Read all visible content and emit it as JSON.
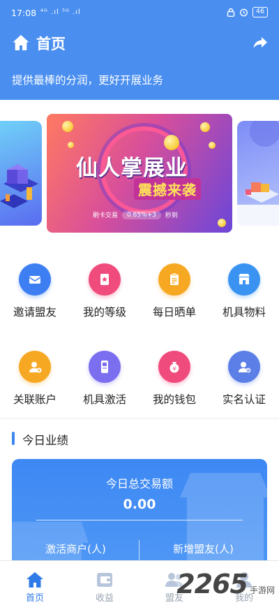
{
  "status": {
    "time": "17:08",
    "signal": "⁴ᴳ .ıl ⁵ᴳ .ıl",
    "battery": "46"
  },
  "header": {
    "title": "首页",
    "tagline": "提供最棒的分润，更好开展业务"
  },
  "banner": {
    "title": "仙人掌展业",
    "subtitle": "震撼来袭",
    "chip_left": "刷卡交易",
    "chip_mid": "0.65%+3",
    "chip_right": "秒到"
  },
  "grid": {
    "items": [
      {
        "label": "邀请盟友",
        "icon": "envelope-icon",
        "color": "#3d7ff2"
      },
      {
        "label": "我的等级",
        "icon": "bookmark-star-icon",
        "color": "#f04b7d"
      },
      {
        "label": "每日晒单",
        "icon": "clipboard-icon",
        "color": "#f7a823"
      },
      {
        "label": "机具物料",
        "icon": "store-icon",
        "color": "#3a93f0"
      },
      {
        "label": "关联账户",
        "icon": "user-add-icon",
        "color": "#f7a823"
      },
      {
        "label": "机具激活",
        "icon": "pos-device-icon",
        "color": "#7b6ff0"
      },
      {
        "label": "我的钱包",
        "icon": "money-bag-icon",
        "color": "#f04b7d"
      },
      {
        "label": "实名认证",
        "icon": "user-verified-icon",
        "color": "#5b7fe6"
      }
    ]
  },
  "performance": {
    "section_title": "今日业绩",
    "total_label": "今日总交易额",
    "total_value": "0.00",
    "col1_label": "激活商户(人)",
    "col2_label": "新增盟友(人)"
  },
  "tabs": [
    {
      "label": "首页",
      "icon": "home-icon"
    },
    {
      "label": "收益",
      "icon": "wallet-icon"
    },
    {
      "label": "盟友",
      "icon": "friends-icon"
    },
    {
      "label": "我的",
      "icon": "profile-icon"
    }
  ],
  "watermark": {
    "big": "2265",
    "small": "手游网"
  },
  "colors": {
    "primary": "#4a8ff0",
    "active_tab": "#2f7ce8"
  }
}
